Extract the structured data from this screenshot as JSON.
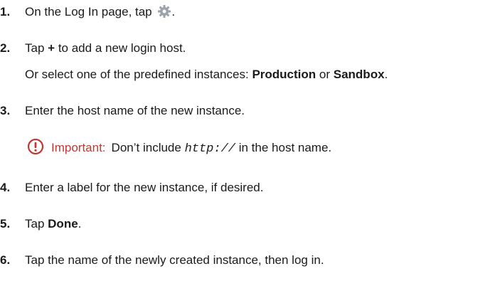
{
  "steps": [
    {
      "num": "1.",
      "before": "On the Log In page, tap",
      "icon": "gear-icon",
      "after": "."
    },
    {
      "num": "2.",
      "before": "Tap",
      "symbol": "+",
      "after": "to add a new login host.",
      "sub": {
        "before": "Or select one of the predefined instances:",
        "opt1": "Production",
        "mid": "or",
        "opt2": "Sandbox",
        "end": "."
      }
    },
    {
      "num": "3.",
      "text": "Enter the host name of the new instance.",
      "note": {
        "icon": "important-icon",
        "label": "Important:",
        "before": "Don’t include",
        "code": "http://",
        "after": "in the host name."
      }
    },
    {
      "num": "4.",
      "text": "Enter a label for the new instance, if desired."
    },
    {
      "num": "5.",
      "before": "Tap",
      "bold": "Done",
      "after": "."
    },
    {
      "num": "6.",
      "text": "Tap the name of the newly created instance, then log in."
    }
  ],
  "colors": {
    "text": "#1a1a1a",
    "important": "#c23934",
    "gear": "#9aa3ab"
  }
}
